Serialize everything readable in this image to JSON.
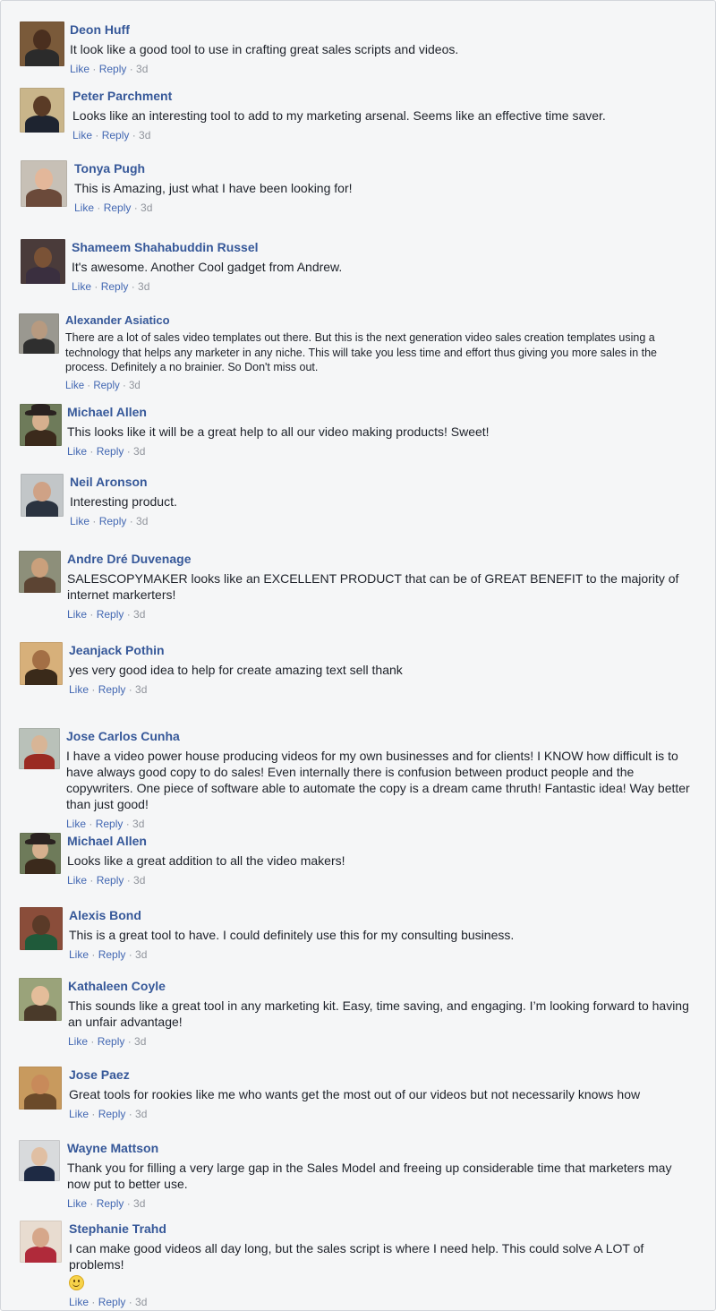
{
  "actions": {
    "like": "Like",
    "reply": "Reply",
    "sep": "·",
    "time": "3d"
  },
  "comments": [
    {
      "name": "Deon Huff",
      "text": "It look like a good tool to use in crafting great sales scripts and videos."
    },
    {
      "name": "Peter Parchment",
      "text": "Looks like an interesting tool to add to my marketing arsenal. Seems like an effective time saver."
    },
    {
      "name": "Tonya Pugh",
      "text": "This is Amazing, just what I have been looking for!"
    },
    {
      "name": "Shameem Shahabuddin Russel",
      "text": "It's awesome. Another Cool gadget from Andrew."
    },
    {
      "name": "Alexander Asiatico",
      "text": "There are a lot of sales video templates out there. But this is the next generation video sales creation templates using a technology that helps any marketer in any niche. This will take you less time and effort thus giving you more sales in the process. Definitely a no brainier. So Don't miss out."
    },
    {
      "name": "Michael Allen",
      "text": "This looks like it will be a great help to all our video making products! Sweet!"
    },
    {
      "name": "Neil Aronson",
      "text": "Interesting product."
    },
    {
      "name": "Andre Dré Duvenage",
      "text": "SALESCOPYMAKER looks like an EXCELLENT PRODUCT that can be of GREAT BENEFIT to the majority of internet markerters!"
    },
    {
      "name": "Jeanjack Pothin",
      "text": "yes very good idea to help for create amazing text sell thank"
    },
    {
      "name": "Jose Carlos Cunha",
      "text": "I have a video power house producing videos for my own businesses and for clients! I KNOW how difficult is to have always good copy to do sales! Even internally there is confusion between product people and the copywriters. One piece of software able to automate the copy is a dream came thruth! Fantastic idea! Way better than just good!"
    },
    {
      "name": "Michael Allen",
      "text": "Looks like a great addition to all the video makers!"
    },
    {
      "name": "Alexis Bond",
      "text": "This is a great tool to have. I could definitely use this for my consulting business."
    },
    {
      "name": "Kathaleen Coyle",
      "text": "This sounds like a great tool in any marketing kit. Easy, time saving, and engaging. I’m looking forward to having an unfair advantage!"
    },
    {
      "name": "Jose Paez",
      "text": "Great tools for rookies like me who wants get the most out of our videos but not necessarily knows how"
    },
    {
      "name": "Wayne Mattson",
      "text": "Thank you for filling a very large gap in the Sales Model and freeing up considerable time that marketers may now put to better use."
    },
    {
      "name": "Stephanie Trahd",
      "text": "I can make good videos all day long, but the sales script is where I need help. This could solve A LOT of problems!",
      "emoji": "smile-emoji"
    }
  ]
}
